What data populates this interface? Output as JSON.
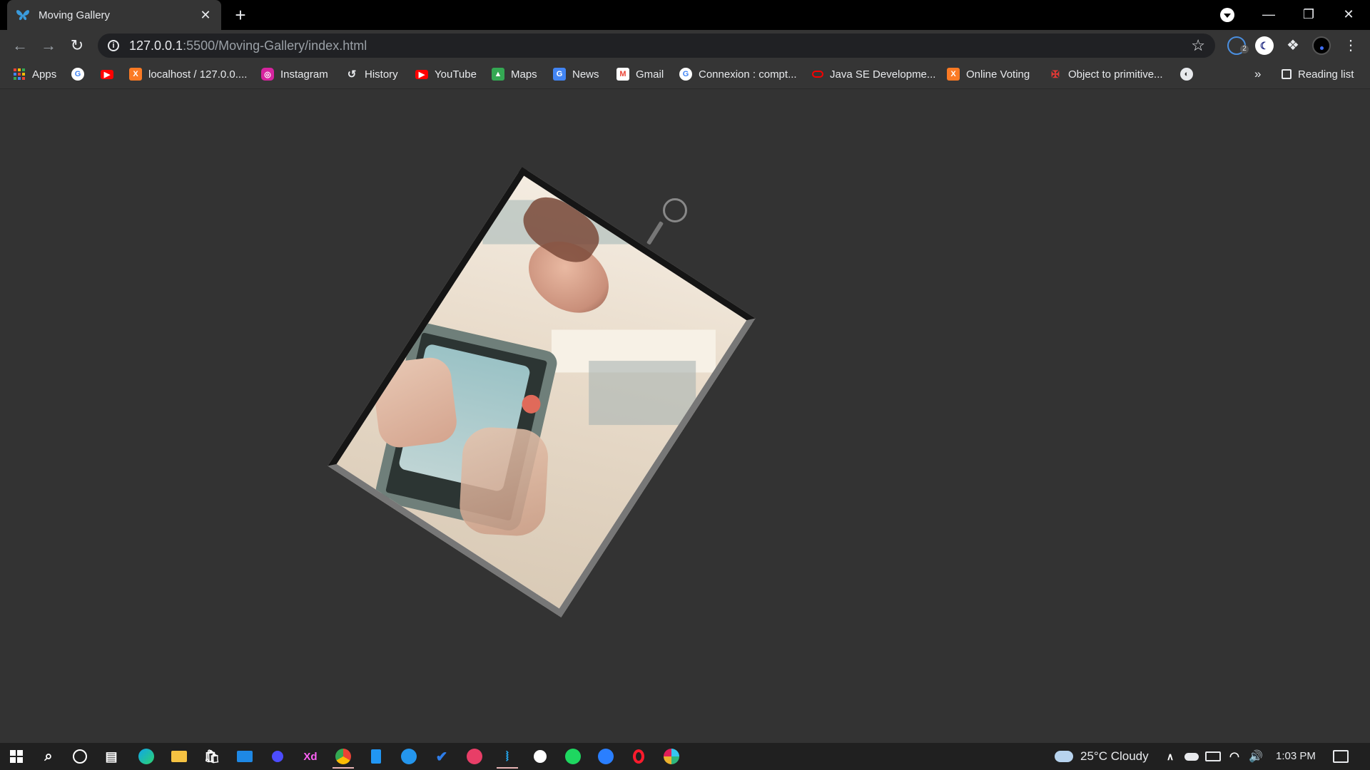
{
  "browser": {
    "tab_title": "Moving Gallery",
    "tab_close": "✕",
    "new_tab": "+",
    "address_host": "127.0.0.1",
    "address_path": ":5500/Moving-Gallery/index.html",
    "extension_badge": "2"
  },
  "bookmarks": {
    "items": [
      {
        "label": "Apps",
        "icon": "apps-grid-icon"
      },
      {
        "label": "",
        "icon": "google-icon"
      },
      {
        "label": "",
        "icon": "youtube-icon"
      },
      {
        "label": "localhost / 127.0.0....",
        "icon": "xampp-icon"
      },
      {
        "label": "Instagram",
        "icon": "instagram-icon"
      },
      {
        "label": "History",
        "icon": "history-icon"
      },
      {
        "label": "YouTube",
        "icon": "youtube-icon"
      },
      {
        "label": "Maps",
        "icon": "maps-icon"
      },
      {
        "label": "News",
        "icon": "news-icon"
      },
      {
        "label": "Gmail",
        "icon": "gmail-icon"
      },
      {
        "label": "Connexion : compt...",
        "icon": "google-icon"
      },
      {
        "label": "Java SE Developme...",
        "icon": "oracle-icon"
      },
      {
        "label": "Online Voting",
        "icon": "xampp-icon"
      },
      {
        "label": "Object to primitive...",
        "icon": "js-icon"
      },
      {
        "label": "",
        "icon": "globe-icon"
      }
    ],
    "overflow": "»",
    "reading_list": "Reading list"
  },
  "taskbar": {
    "weather": "25°C  Cloudy",
    "clock": "1:03 PM"
  }
}
